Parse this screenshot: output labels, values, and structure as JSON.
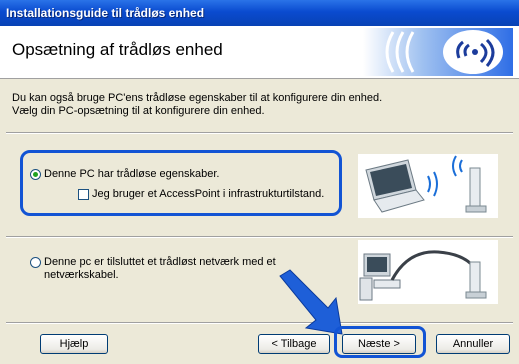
{
  "window": {
    "title": "Installationsguide til trådløs enhed"
  },
  "header": {
    "title": "Opsætning af trådløs enhed"
  },
  "intro": {
    "line1": "Du kan også bruge PC'ens trådløse egenskaber til at konfigurere din enhed.",
    "line2": "Vælg din PC-opsætning til at konfigurere din enhed."
  },
  "options": {
    "wireless_pc": {
      "label": "Denne PC har trådløse egenskaber.",
      "selected": true
    },
    "access_point": {
      "label": "Jeg bruger et AccessPoint i infrastrukturtilstand.",
      "checked": false
    },
    "wired_pc": {
      "label_line1": "Denne pc er tilsluttet et trådløst netværk med et",
      "label_line2": "netværkskabel.",
      "selected": false
    }
  },
  "buttons": {
    "help": "Hjælp",
    "back": "< Tilbage",
    "next": "Næste >",
    "cancel": "Annuller"
  },
  "colors": {
    "highlight": "#1254d4",
    "titlebar": "#0a4bd0",
    "dialog_bg": "#ece9d8"
  },
  "icons": {
    "logo": "wireless-signal-logo",
    "arrow": "pointer-arrow",
    "laptop": "laptop-icon",
    "desktop": "desktop-pc-icon",
    "device": "wireless-device-icon"
  }
}
